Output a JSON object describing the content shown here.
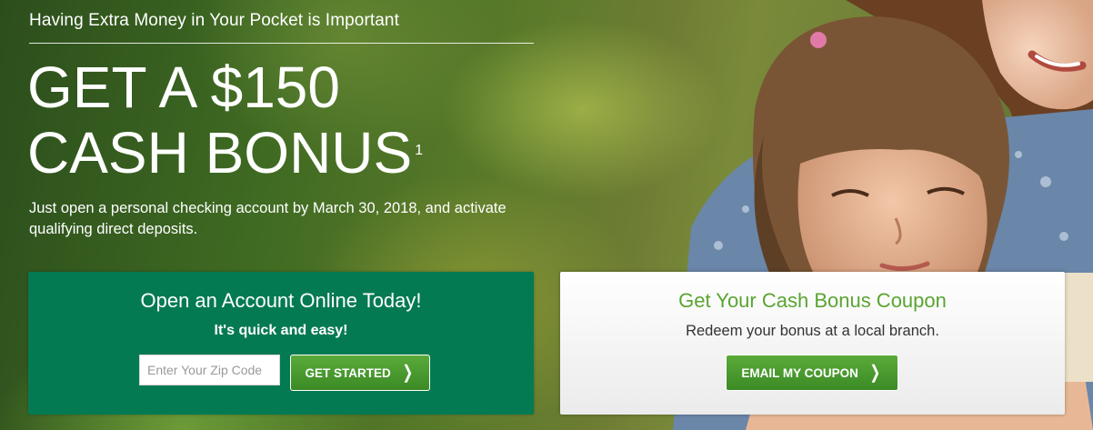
{
  "hero": {
    "tagline": "Having Extra Money in Your Pocket is Important",
    "headline_line1": "GET A $150",
    "headline_line2": "CASH BONUS",
    "footnote_mark": "1",
    "subtext": "Just open a personal checking account by March 30, 2018, and activate qualifying direct deposits."
  },
  "online_panel": {
    "title": "Open an Account Online Today!",
    "subtitle": "It's quick and easy!",
    "zip_placeholder": "Enter Your Zip Code",
    "zip_value": "",
    "button_label": "GET STARTED",
    "button_icon": "chevron-right-icon"
  },
  "coupon_panel": {
    "title": "Get Your Cash Bonus Coupon",
    "subtitle": "Redeem your bonus at a local branch.",
    "button_label": "EMAIL MY COUPON",
    "button_icon": "chevron-right-icon"
  },
  "colors": {
    "green_panel": "#047a52",
    "button_green": "#4a9b30",
    "coupon_title": "#5aa531"
  }
}
